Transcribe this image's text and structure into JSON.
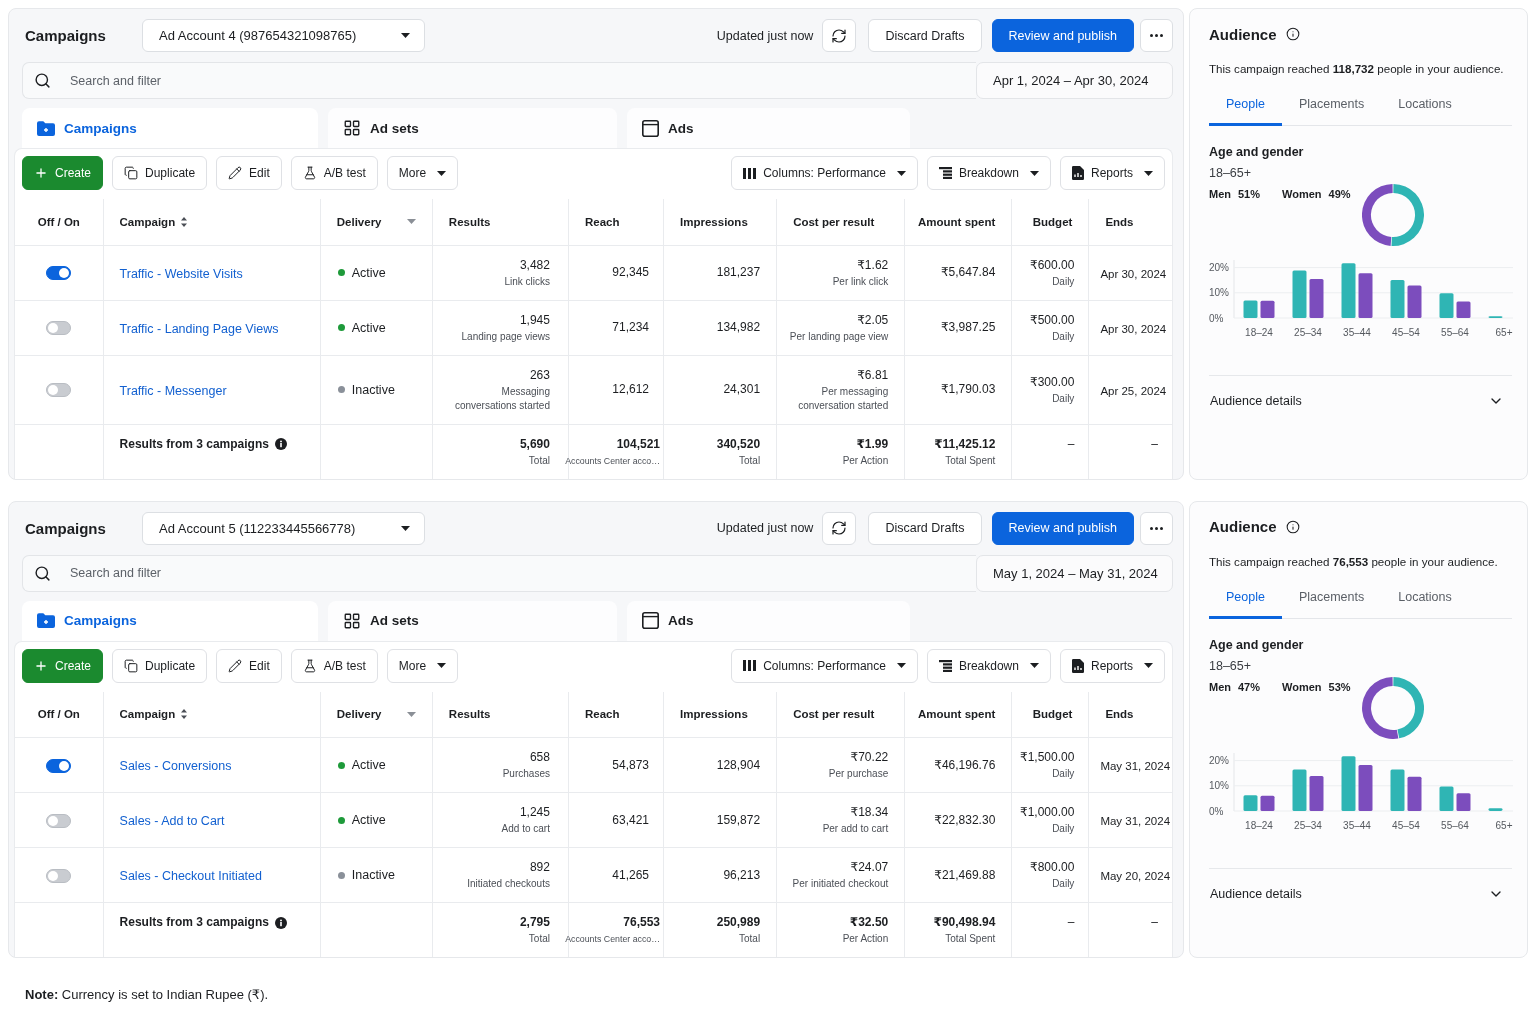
{
  "sections": [
    {
      "manager": {
        "title": "Campaigns",
        "account": "Ad Account 4 (987654321098765)",
        "status": "Updated just now",
        "buttons": [
          {
            "label": "Discard Drafts",
            "kind": "discard"
          },
          {
            "label": "Review and publish",
            "kind": "publish"
          }
        ],
        "search": {
          "placeholder": "Search and filter"
        },
        "date_range": "Apr 1, 2024 – Apr 30, 2024",
        "level_tabs": [
          {
            "label": "Campaigns",
            "kind": "campaigns",
            "selected": true
          },
          {
            "label": "Ad sets",
            "kind": "adsets",
            "selected": false
          },
          {
            "label": "Ads",
            "kind": "ads",
            "selected": false
          }
        ],
        "actions": [
          {
            "label": "Create",
            "kind": "create"
          },
          {
            "label": "Duplicate",
            "kind": "duplicate"
          },
          {
            "label": "Edit",
            "kind": "edit"
          },
          {
            "label": "A/B test",
            "kind": "test"
          },
          {
            "label": "More",
            "kind": "menu"
          }
        ],
        "views": [
          {
            "label": "Columns: Performance",
            "kind": "columns"
          },
          {
            "label": "Breakdown",
            "kind": "breakdown"
          },
          {
            "label": "Reports",
            "kind": "reports"
          }
        ],
        "table": {
          "columns": [
            {
              "label": "Off / On",
              "kind": "plain"
            },
            {
              "label": "Campaign",
              "kind": "sortable"
            },
            {
              "label": "Delivery",
              "kind": "filter"
            },
            {
              "label": "Results",
              "kind": "plain"
            },
            {
              "label": "Reach",
              "kind": "plain"
            },
            {
              "label": "Impressions",
              "kind": "plain"
            },
            {
              "label": "Cost per result",
              "kind": "plain"
            },
            {
              "label": "Amount spent",
              "kind": "plain"
            },
            {
              "label": "Budget",
              "kind": "plain"
            },
            {
              "label": "Ends",
              "kind": "plain"
            }
          ],
          "rows": [
            {
              "on": true,
              "campaign": "Traffic - Website Visits",
              "delivery": {
                "label": "Active",
                "color": "#1e9a3a"
              },
              "results": {
                "value": "3,482",
                "caption": "Link clicks"
              },
              "reach": "92,345",
              "impressions": "181,237",
              "cost_per_result": {
                "value": "₹1.62",
                "caption": "Per link click"
              },
              "amount_spent": "₹5,647.84",
              "budget": {
                "value": "₹600.00",
                "caption": "Daily"
              },
              "ends": "Apr 30, 2024"
            },
            {
              "on": false,
              "campaign": "Traffic - Landing Page Views",
              "delivery": {
                "label": "Active",
                "color": "#1e9a3a"
              },
              "results": {
                "value": "1,945",
                "caption": "Landing page views"
              },
              "reach": "71,234",
              "impressions": "134,982",
              "cost_per_result": {
                "value": "₹2.05",
                "caption": "Per landing page view"
              },
              "amount_spent": "₹3,987.25",
              "budget": {
                "value": "₹500.00",
                "caption": "Daily"
              },
              "ends": "Apr 30, 2024"
            },
            {
              "on": false,
              "campaign": "Traffic - Messenger",
              "delivery": {
                "label": "Inactive",
                "color": "#8a9099"
              },
              "results": {
                "value": "263",
                "caption": "Messaging conversations started"
              },
              "reach": "12,612",
              "impressions": "24,301",
              "cost_per_result": {
                "value": "₹6.81",
                "caption": "Per messaging conversation started"
              },
              "amount_spent": "₹1,790.03",
              "budget": {
                "value": "₹300.00",
                "caption": "Daily"
              },
              "ends": "Apr 25, 2024"
            }
          ],
          "totals": {
            "label": "Results from 3 campaigns",
            "results": {
              "value": "5,690",
              "caption": "Total"
            },
            "reach": {
              "value": "104,521",
              "caption": "Accounts Center acco…"
            },
            "impressions": {
              "value": "340,520",
              "caption": "Total"
            },
            "cost_per_result": {
              "value": "₹1.99",
              "caption": "Per Action"
            },
            "amount_spent": {
              "value": "₹11,425.12",
              "caption": "Total Spent"
            },
            "budget": "–",
            "ends": "–"
          }
        }
      },
      "audience": {
        "title": "Audience",
        "summary": "This campaign reached **118,732** people in your audience.",
        "tabs": [
          {
            "label": "People",
            "selected": true
          },
          {
            "label": "Placements",
            "selected": false
          },
          {
            "label": "Locations",
            "selected": false
          }
        ],
        "heading": "Age and gender",
        "age_range": "18–65+",
        "gender": [
          {
            "label": "Men",
            "share": "51%"
          },
          {
            "label": "Women",
            "share": "49%"
          }
        ],
        "gender_chart": {
          "chart_data": {
            "type": "donut",
            "values": [
              51,
              49
            ]
          }
        },
        "age_chart": {
          "chart_data": {
            "type": "bar",
            "categories": [
              "18–24",
              "25–34",
              "35–44",
              "45–54",
              "55–64",
              "65+"
            ],
            "series": [
              {
                "color": "#2fb5b4",
                "values": [
                  6.9,
                  18.8,
                  21.7,
                  15.1,
                  9.8,
                  0.7
                ]
              },
              {
                "color": "#7c4dbd",
                "values": [
                  6.8,
                  15.5,
                  17.7,
                  12.9,
                  6.5,
                  0
                ]
              }
            ],
            "ylim": [
              0,
              23
            ],
            "yticks": [
              {
                "value": 0,
                "label": "0%"
              },
              {
                "value": 10,
                "label": "10%"
              },
              {
                "value": 20,
                "label": "20%"
              }
            ]
          }
        },
        "details": {
          "label": "Audience details",
          "expanded": false
        }
      }
    },
    {
      "manager": {
        "title": "Campaigns",
        "account": "Ad Account 5 (112233445566778)",
        "status": "Updated just now",
        "buttons": [
          {
            "label": "Discard Drafts",
            "kind": "discard"
          },
          {
            "label": "Review and publish",
            "kind": "publish"
          }
        ],
        "search": {
          "placeholder": "Search and filter"
        },
        "date_range": "May 1, 2024 – May 31, 2024",
        "level_tabs": [
          {
            "label": "Campaigns",
            "kind": "campaigns",
            "selected": true
          },
          {
            "label": "Ad sets",
            "kind": "adsets",
            "selected": false
          },
          {
            "label": "Ads",
            "kind": "ads",
            "selected": false
          }
        ],
        "actions": [
          {
            "label": "Create",
            "kind": "create"
          },
          {
            "label": "Duplicate",
            "kind": "duplicate"
          },
          {
            "label": "Edit",
            "kind": "edit"
          },
          {
            "label": "A/B test",
            "kind": "test"
          },
          {
            "label": "More",
            "kind": "menu"
          }
        ],
        "views": [
          {
            "label": "Columns: Performance",
            "kind": "columns"
          },
          {
            "label": "Breakdown",
            "kind": "breakdown"
          },
          {
            "label": "Reports",
            "kind": "reports"
          }
        ],
        "table": {
          "columns": [
            {
              "label": "Off / On",
              "kind": "plain"
            },
            {
              "label": "Campaign",
              "kind": "sortable"
            },
            {
              "label": "Delivery",
              "kind": "filter"
            },
            {
              "label": "Results",
              "kind": "plain"
            },
            {
              "label": "Reach",
              "kind": "plain"
            },
            {
              "label": "Impressions",
              "kind": "plain"
            },
            {
              "label": "Cost per result",
              "kind": "plain"
            },
            {
              "label": "Amount spent",
              "kind": "plain"
            },
            {
              "label": "Budget",
              "kind": "plain"
            },
            {
              "label": "Ends",
              "kind": "plain"
            }
          ],
          "rows": [
            {
              "on": true,
              "campaign": "Sales - Conversions",
              "delivery": {
                "label": "Active",
                "color": "#1e9a3a"
              },
              "results": {
                "value": "658",
                "caption": "Purchases"
              },
              "reach": "54,873",
              "impressions": "128,904",
              "cost_per_result": {
                "value": "₹70.22",
                "caption": "Per purchase"
              },
              "amount_spent": "₹46,196.76",
              "budget": {
                "value": "₹1,500.00",
                "caption": "Daily"
              },
              "ends": "May 31, 2024"
            },
            {
              "on": false,
              "campaign": "Sales - Add to Cart",
              "delivery": {
                "label": "Active",
                "color": "#1e9a3a"
              },
              "results": {
                "value": "1,245",
                "caption": "Add to cart"
              },
              "reach": "63,421",
              "impressions": "159,872",
              "cost_per_result": {
                "value": "₹18.34",
                "caption": "Per add to cart"
              },
              "amount_spent": "₹22,832.30",
              "budget": {
                "value": "₹1,000.00",
                "caption": "Daily"
              },
              "ends": "May 31, 2024"
            },
            {
              "on": false,
              "campaign": "Sales - Checkout Initiated",
              "delivery": {
                "label": "Inactive",
                "color": "#8a9099"
              },
              "results": {
                "value": "892",
                "caption": "Initiated checkouts"
              },
              "reach": "41,265",
              "impressions": "96,213",
              "cost_per_result": {
                "value": "₹24.07",
                "caption": "Per initiated checkout"
              },
              "amount_spent": "₹21,469.88",
              "budget": {
                "value": "₹800.00",
                "caption": "Daily"
              },
              "ends": "May 20, 2024"
            }
          ],
          "totals": {
            "label": "Results from 3 campaigns",
            "results": {
              "value": "2,795",
              "caption": "Total"
            },
            "reach": {
              "value": "76,553",
              "caption": "Accounts Center acco…"
            },
            "impressions": {
              "value": "250,989",
              "caption": "Total"
            },
            "cost_per_result": {
              "value": "₹32.50",
              "caption": "Per Action"
            },
            "amount_spent": {
              "value": "₹90,498.94",
              "caption": "Total Spent"
            },
            "budget": "–",
            "ends": "–"
          }
        }
      },
      "audience": {
        "title": "Audience",
        "summary": "This campaign reached **76,553** people in your audience.",
        "tabs": [
          {
            "label": "People",
            "selected": true
          },
          {
            "label": "Placements",
            "selected": false
          },
          {
            "label": "Locations",
            "selected": false
          }
        ],
        "heading": "Age and gender",
        "age_range": "18–65+",
        "gender": [
          {
            "label": "Men",
            "share": "47%"
          },
          {
            "label": "Women",
            "share": "53%"
          }
        ],
        "gender_chart": {
          "chart_data": {
            "type": "donut",
            "values": [
              47,
              53
            ]
          }
        },
        "age_chart": {
          "chart_data": {
            "type": "bar",
            "categories": [
              "18–24",
              "25–34",
              "35–44",
              "45–54",
              "55–64",
              "65+"
            ],
            "series": [
              {
                "color": "#2fb5b4",
                "values": [
                  6.2,
                  16.5,
                  21.7,
                  16.5,
                  9.7,
                  1.1
                ]
              },
              {
                "color": "#7c4dbd",
                "values": [
                  6.0,
                  13.9,
                  18.2,
                  13.6,
                  7.0,
                  0
                ]
              }
            ],
            "ylim": [
              0,
              23
            ],
            "yticks": [
              {
                "value": 0,
                "label": "0%"
              },
              {
                "value": 10,
                "label": "10%"
              },
              {
                "value": 20,
                "label": "20%"
              }
            ]
          }
        },
        "details": {
          "label": "Audience details",
          "expanded": false
        }
      }
    }
  ],
  "note": "**Note:** Currency is set to Indian Rupee (₹)."
}
